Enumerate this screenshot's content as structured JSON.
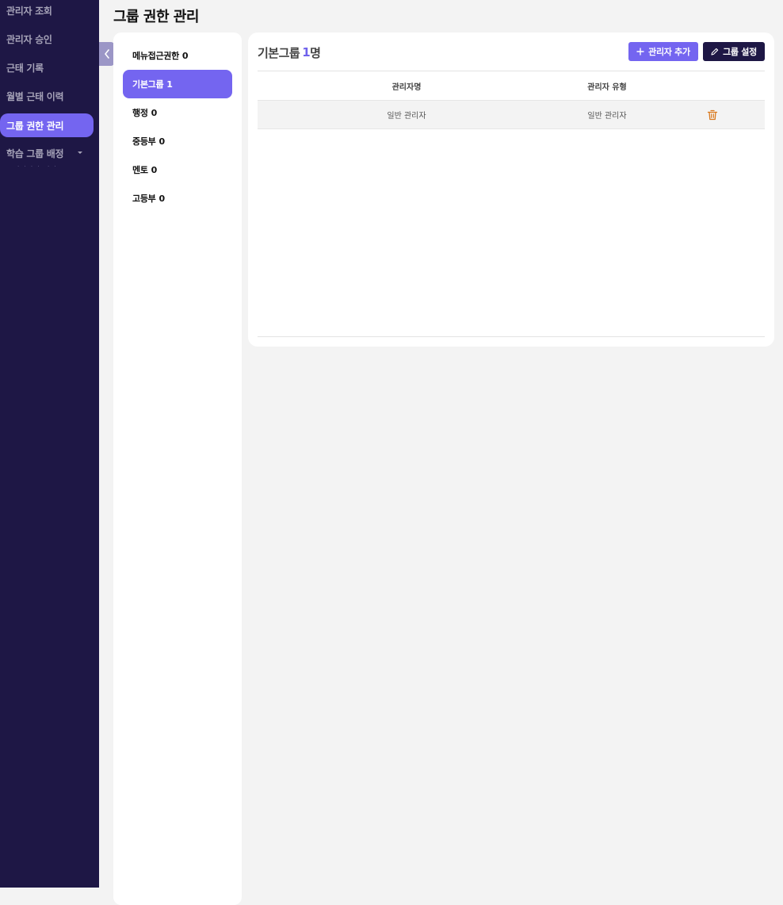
{
  "page": {
    "title": "그룹 권한 관리"
  },
  "sidebar": {
    "items": [
      {
        "label": "관리자 조회"
      },
      {
        "label": "관리자 승인"
      },
      {
        "label": "근태 기록"
      },
      {
        "label": "월별 근태 이력"
      },
      {
        "label": "그룹 권한 관리",
        "active": true
      },
      {
        "label": "학습 그룹 배정",
        "has_dropdown": true
      }
    ],
    "active_color": "#7465f0",
    "background_color": "#1e1745"
  },
  "groups": {
    "items": [
      {
        "name": "메뉴접근권한",
        "count": "0"
      },
      {
        "name": "기본그룹",
        "count": "1",
        "active": true
      },
      {
        "name": "행정",
        "count": "0"
      },
      {
        "name": "중등부",
        "count": "0"
      },
      {
        "name": "멘토",
        "count": "0"
      },
      {
        "name": "고등부",
        "count": "0"
      }
    ]
  },
  "detail": {
    "group_name": "기본그룹",
    "member_count": "1",
    "member_unit": "명",
    "add_button_label": "관리자 추가",
    "settings_button_label": "그룹 설정",
    "columns": [
      "관리자명",
      "관리자 유형"
    ],
    "rows": [
      {
        "name": "일반 관리자",
        "type": "일반 관리자"
      }
    ],
    "icons": {
      "add": "plus-icon",
      "settings": "pencil-icon",
      "delete": "trash-icon",
      "collapse": "chevron-left-icon"
    },
    "delete_icon_color": "#d9781c"
  }
}
